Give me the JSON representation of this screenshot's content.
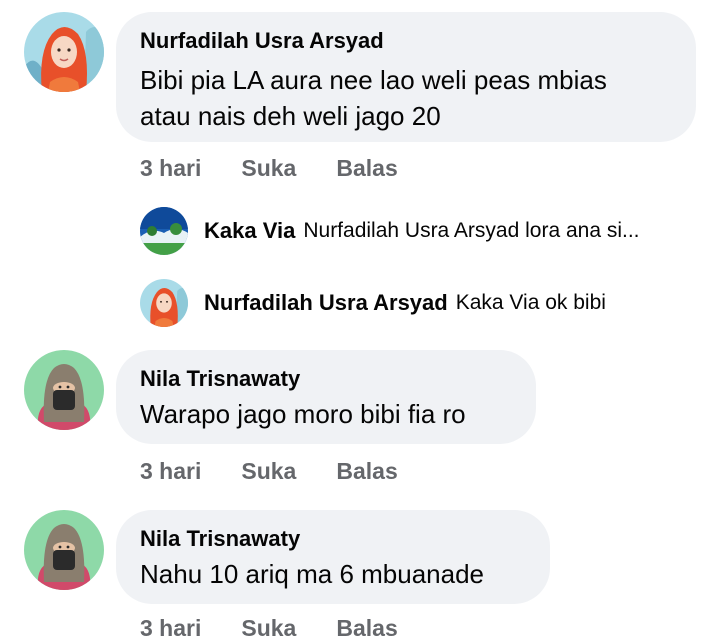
{
  "comments": [
    {
      "author": "Nurfadilah Usra Arsyad",
      "text_line1": "Bibi pia LA aura nee lao weli peas mbias",
      "text_line2": "atau nais deh  weli jago 20",
      "time": "3 hari",
      "like": "Suka",
      "reply": "Balas",
      "avatar_icon": "hijab-woman-avatar"
    },
    {
      "author": "Nila Trisnawaty",
      "text": "Warapo jago moro bibi fia ro",
      "time": "3 hari",
      "like": "Suka",
      "reply": "Balas",
      "avatar_icon": "niqab-woman-avatar"
    },
    {
      "author": "Nila Trisnawaty",
      "text": "Nahu 10 ariq ma 6 mbuanade",
      "time": "3 hari",
      "like": "Suka",
      "reply": "Balas",
      "avatar_icon": "niqab-woman-avatar"
    }
  ],
  "replies": [
    {
      "author": "Kaka Via",
      "text": "Nurfadilah Usra Arsyad lora ana si...",
      "avatar_icon": "landscape-avatar"
    },
    {
      "author": "Nurfadilah Usra Arsyad",
      "text": "Kaka Via ok bibi",
      "avatar_icon": "hijab-woman-avatar"
    }
  ],
  "colors": {
    "bubble_bg": "#f0f2f5",
    "action_text": "#65676b",
    "name_text": "#050505"
  }
}
